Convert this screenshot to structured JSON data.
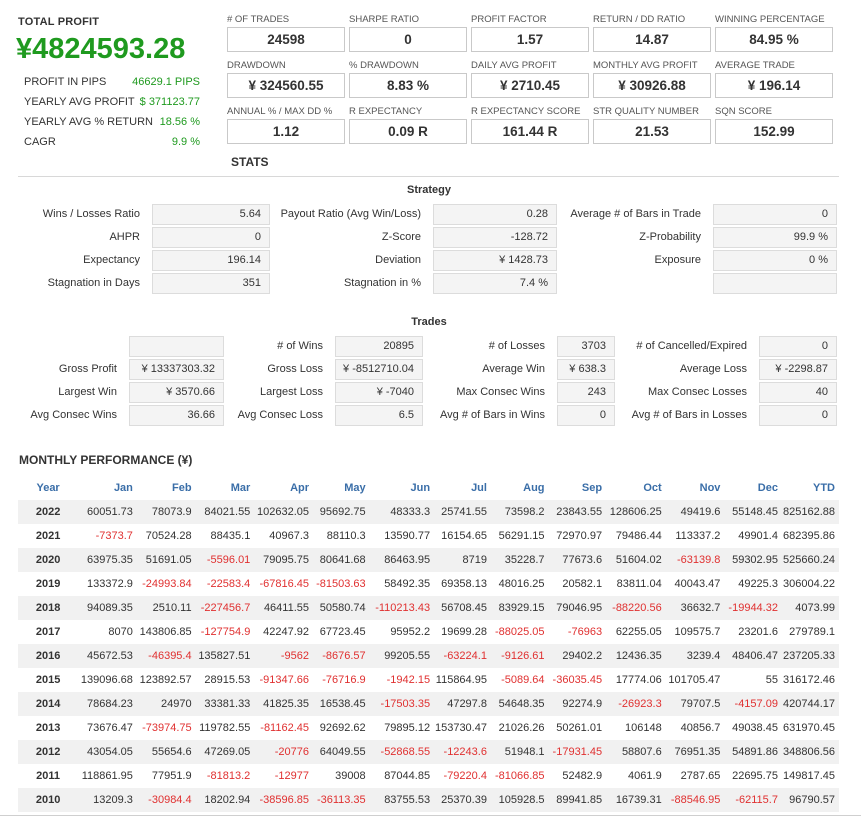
{
  "total": {
    "label": "TOTAL PROFIT",
    "value": "¥4824593.28",
    "rows": [
      {
        "k": "PROFIT IN PIPS",
        "v": "46629.1 PIPS"
      },
      {
        "k": "YEARLY AVG PROFIT",
        "v": "$ 371123.77"
      },
      {
        "k": "YEARLY AVG % RETURN",
        "v": "18.56 %"
      },
      {
        "k": "CAGR",
        "v": "9.9 %"
      }
    ]
  },
  "metrics": [
    {
      "label": "# OF TRADES",
      "value": "24598"
    },
    {
      "label": "SHARPE RATIO",
      "value": "0"
    },
    {
      "label": "PROFIT FACTOR",
      "value": "1.57"
    },
    {
      "label": "RETURN / DD RATIO",
      "value": "14.87"
    },
    {
      "label": "WINNING PERCENTAGE",
      "value": "84.95 %"
    },
    {
      "label": "DRAWDOWN",
      "value": "¥ 324560.55"
    },
    {
      "label": "% DRAWDOWN",
      "value": "8.83 %"
    },
    {
      "label": "DAILY AVG PROFIT",
      "value": "¥ 2710.45"
    },
    {
      "label": "MONTHLY AVG PROFIT",
      "value": "¥ 30926.88"
    },
    {
      "label": "AVERAGE TRADE",
      "value": "¥ 196.14"
    },
    {
      "label": "ANNUAL % / MAX DD %",
      "value": "1.12"
    },
    {
      "label": "R EXPECTANCY",
      "value": "0.09 R"
    },
    {
      "label": "R EXPECTANCY SCORE",
      "value": "161.44 R"
    },
    {
      "label": "STR QUALITY NUMBER",
      "value": "21.53"
    },
    {
      "label": "SQN SCORE",
      "value": "152.99"
    }
  ],
  "stats_title": "STATS",
  "strategy": {
    "title": "Strategy",
    "rows": [
      [
        [
          "Wins / Losses Ratio",
          "5.64"
        ],
        [
          "Payout Ratio (Avg Win/Loss)",
          "0.28"
        ],
        [
          "Average # of Bars in Trade",
          "0"
        ]
      ],
      [
        [
          "AHPR",
          "0"
        ],
        [
          "Z-Score",
          "-128.72"
        ],
        [
          "Z-Probability",
          "99.9 %"
        ]
      ],
      [
        [
          "Expectancy",
          "196.14"
        ],
        [
          "Deviation",
          "¥ 1428.73"
        ],
        [
          "Exposure",
          "0 %"
        ]
      ],
      [
        [
          "Stagnation in Days",
          "351"
        ],
        [
          "Stagnation in %",
          "7.4 %"
        ],
        [
          "",
          ""
        ]
      ]
    ]
  },
  "trades": {
    "title": "Trades",
    "rows": [
      [
        [
          "",
          ""
        ],
        [
          "# of Wins",
          "20895"
        ],
        [
          "# of Losses",
          "3703"
        ],
        [
          "# of Cancelled/Expired",
          "0"
        ]
      ],
      [
        [
          "Gross Profit",
          "¥ 13337303.32"
        ],
        [
          "Gross Loss",
          "¥ -8512710.04"
        ],
        [
          "Average Win",
          "¥ 638.3"
        ],
        [
          "Average Loss",
          "¥ -2298.87"
        ]
      ],
      [
        [
          "Largest Win",
          "¥ 3570.66"
        ],
        [
          "Largest Loss",
          "¥ -7040"
        ],
        [
          "Max Consec Wins",
          "243"
        ],
        [
          "Max Consec Losses",
          "40"
        ]
      ],
      [
        [
          "Avg Consec Wins",
          "36.66"
        ],
        [
          "Avg Consec Loss",
          "6.5"
        ],
        [
          "Avg # of Bars in Wins",
          "0"
        ],
        [
          "Avg # of Bars in Losses",
          "0"
        ]
      ]
    ]
  },
  "monthly": {
    "title": "MONTHLY PERFORMANCE (¥)",
    "headers": [
      "Year",
      "Jan",
      "Feb",
      "Mar",
      "Apr",
      "May",
      "Jun",
      "Jul",
      "Aug",
      "Sep",
      "Oct",
      "Nov",
      "Dec",
      "YTD"
    ],
    "rows": [
      [
        "2022",
        "60051.73",
        "78073.9",
        "84021.55",
        "102632.05",
        "95692.75",
        "48333.3",
        "25741.55",
        "73598.2",
        "23843.55",
        "128606.25",
        "49419.6",
        "55148.45",
        "825162.88"
      ],
      [
        "2021",
        "-7373.7",
        "70524.28",
        "88435.1",
        "40967.3",
        "88110.3",
        "13590.77",
        "16154.65",
        "56291.15",
        "72970.97",
        "79486.44",
        "113337.2",
        "49901.4",
        "682395.86"
      ],
      [
        "2020",
        "63975.35",
        "51691.05",
        "-5596.01",
        "79095.75",
        "80641.68",
        "86463.95",
        "8719",
        "35228.7",
        "77673.6",
        "51604.02",
        "-63139.8",
        "59302.95",
        "525660.24"
      ],
      [
        "2019",
        "133372.9",
        "-24993.84",
        "-22583.4",
        "-67816.45",
        "-81503.63",
        "58492.35",
        "69358.13",
        "48016.25",
        "20582.1",
        "83811.04",
        "40043.47",
        "49225.3",
        "306004.22"
      ],
      [
        "2018",
        "94089.35",
        "2510.11",
        "-227456.7",
        "46411.55",
        "50580.74",
        "-110213.43",
        "56708.45",
        "83929.15",
        "79046.95",
        "-88220.56",
        "36632.7",
        "-19944.32",
        "4073.99"
      ],
      [
        "2017",
        "8070",
        "143806.85",
        "-127754.9",
        "42247.92",
        "67723.45",
        "95952.2",
        "19699.28",
        "-88025.05",
        "-76963",
        "62255.05",
        "109575.7",
        "23201.6",
        "279789.1"
      ],
      [
        "2016",
        "45672.53",
        "-46395.4",
        "135827.51",
        "-9562",
        "-8676.57",
        "99205.55",
        "-63224.1",
        "-9126.61",
        "29402.2",
        "12436.35",
        "3239.4",
        "48406.47",
        "237205.33"
      ],
      [
        "2015",
        "139096.68",
        "123892.57",
        "28915.53",
        "-91347.66",
        "-76716.9",
        "-1942.15",
        "115864.95",
        "-5089.64",
        "-36035.45",
        "17774.06",
        "101705.47",
        "55",
        "316172.46"
      ],
      [
        "2014",
        "78684.23",
        "24970",
        "33381.33",
        "41825.35",
        "16538.45",
        "-17503.35",
        "47297.8",
        "54648.35",
        "92274.9",
        "-26923.3",
        "79707.5",
        "-4157.09",
        "420744.17"
      ],
      [
        "2013",
        "73676.47",
        "-73974.75",
        "119782.55",
        "-81162.45",
        "92692.62",
        "79895.12",
        "153730.47",
        "21026.26",
        "50261.01",
        "106148",
        "40856.7",
        "49038.45",
        "631970.45"
      ],
      [
        "2012",
        "43054.05",
        "55654.6",
        "47269.05",
        "-20776",
        "64049.55",
        "-52868.55",
        "-12243.6",
        "51948.1",
        "-17931.45",
        "58807.6",
        "76951.35",
        "54891.86",
        "348806.56"
      ],
      [
        "2011",
        "118861.95",
        "77951.9",
        "-81813.2",
        "-12977",
        "39008",
        "87044.85",
        "-79220.4",
        "-81066.85",
        "52482.9",
        "4061.9",
        "2787.65",
        "22695.75",
        "149817.45"
      ],
      [
        "2010",
        "13209.3",
        "-30984.4",
        "18202.94",
        "-38596.85",
        "-36113.35",
        "83755.53",
        "25370.39",
        "105928.5",
        "89941.85",
        "16739.31",
        "-88546.95",
        "-62115.7",
        "96790.57"
      ]
    ]
  }
}
